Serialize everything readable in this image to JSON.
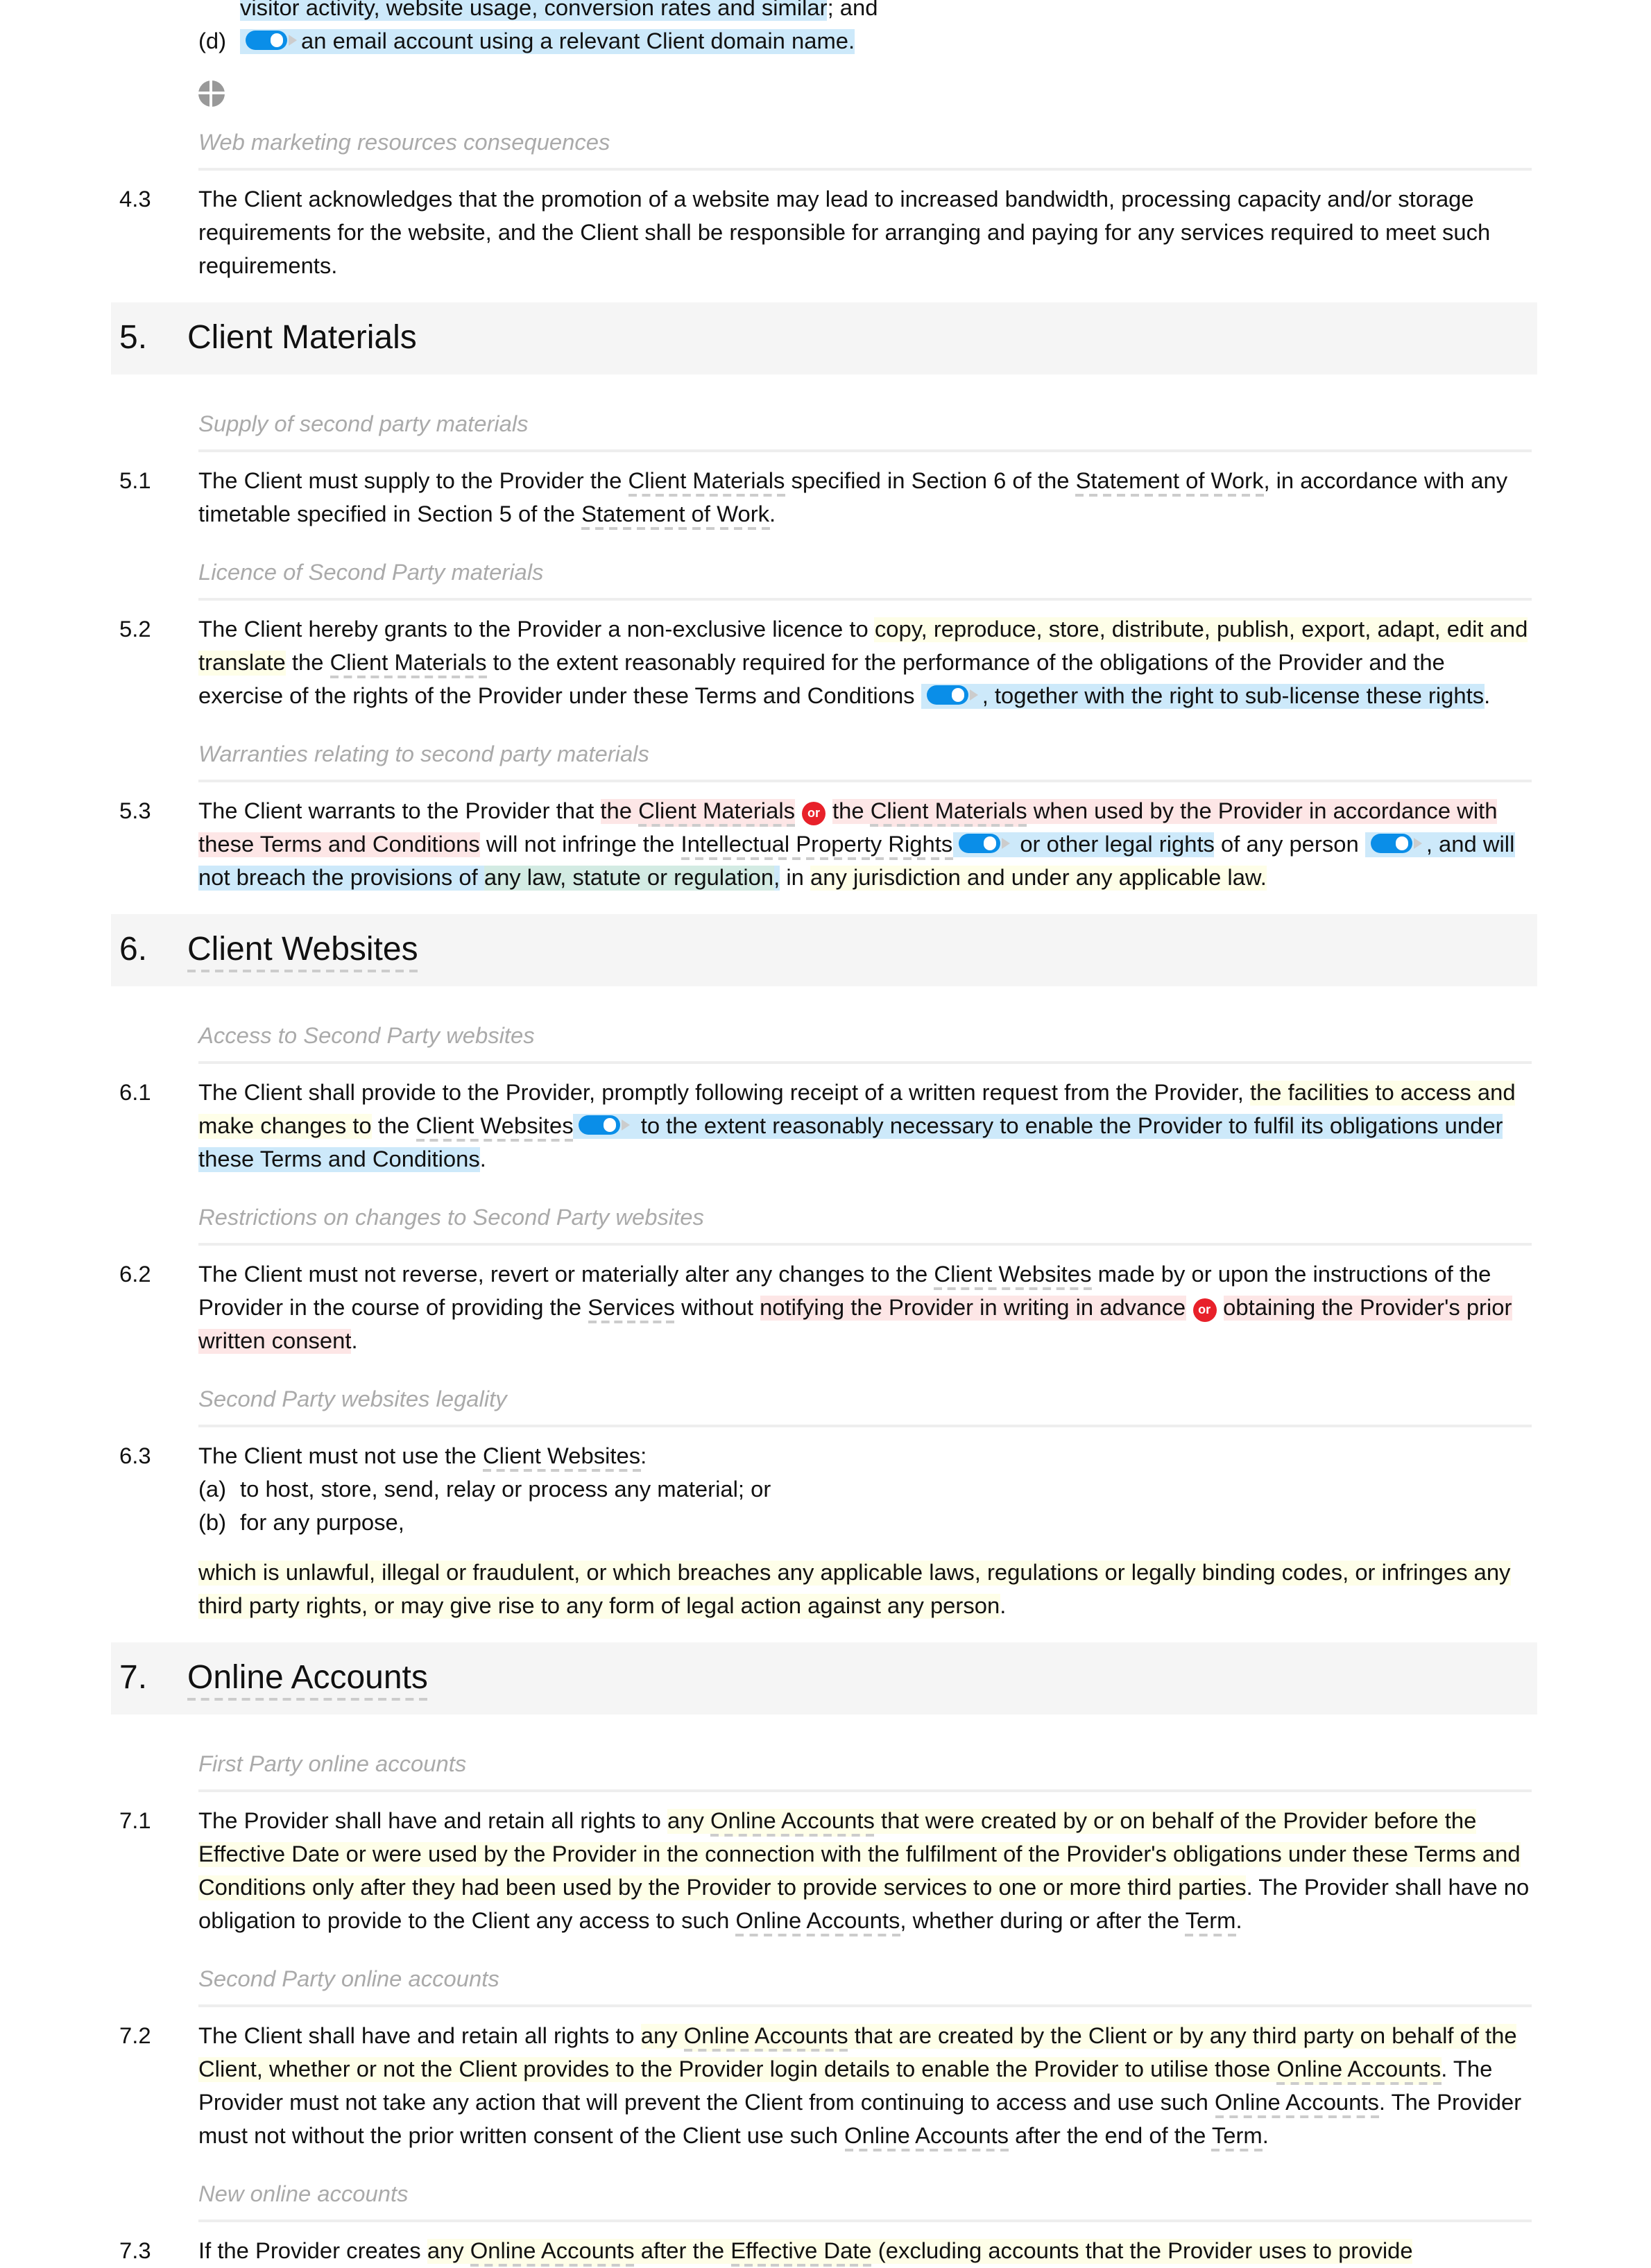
{
  "intro": {
    "c_tail": [
      {
        "t": "visitor activity, website usage, conversion rates and similar",
        "h": "b"
      },
      {
        "t": "; and"
      }
    ],
    "d_label": "(d)",
    "d_segs": [
      {
        "toggle": true,
        "h": "b"
      },
      {
        "t": "an email account using a relevant Client domain name.",
        "h": "b"
      }
    ]
  },
  "blocks": [
    {
      "type": "sub",
      "text": "Web marketing resources consequences"
    },
    {
      "type": "para",
      "num": "4.3",
      "segs": [
        {
          "t": "The Client acknowledges that the promotion of a website may lead to increased bandwidth, processing capacity and/or storage requirements for the website, and the Client shall be responsible for arranging and paying for any services required to meet such requirements."
        }
      ]
    },
    {
      "type": "heading",
      "num": "5.",
      "title": "Client Materials",
      "term": false
    },
    {
      "type": "sub",
      "text": "Supply of second party materials"
    },
    {
      "type": "para",
      "num": "5.1",
      "segs": [
        {
          "t": "The Client must supply to the Provider the "
        },
        {
          "t": "Client Materials",
          "d": 1
        },
        {
          "t": " specified in Section 6 of the "
        },
        {
          "t": "Statement of Work",
          "d": 1
        },
        {
          "t": ", in accordance with any timetable specified in Section 5 of the "
        },
        {
          "t": "Statement of Work",
          "d": 1
        },
        {
          "t": "."
        }
      ]
    },
    {
      "type": "sub",
      "text": "Licence of Second Party materials"
    },
    {
      "type": "para",
      "num": "5.2",
      "segs": [
        {
          "t": "The Client hereby grants to the Provider a non-exclusive licence to "
        },
        {
          "t": "copy, reproduce, store, distribute, publish, export, adapt, edit and translate",
          "h": "y"
        },
        {
          "t": " the "
        },
        {
          "t": "Client Materials",
          "d": 1
        },
        {
          "t": " to the extent reasonably required for the performance of the obligations of the Provider and the exercise of the rights of the Provider under these Terms and Conditions "
        },
        {
          "toggle": true,
          "h": "b"
        },
        {
          "t": ", together with the right to sub-license these rights",
          "h": "b"
        },
        {
          "t": "."
        }
      ]
    },
    {
      "type": "sub",
      "text": "Warranties relating to second party materials"
    },
    {
      "type": "para",
      "num": "5.3",
      "segs": [
        {
          "t": "The Client warrants to the Provider that "
        },
        {
          "t": "the ",
          "h": "p"
        },
        {
          "t": "Client Materials",
          "h": "p",
          "d": 1
        },
        {
          "or": "or"
        },
        {
          "t": "the ",
          "h": "p"
        },
        {
          "t": "Client Materials",
          "h": "p",
          "d": 1
        },
        {
          "t": " when used by the Provider in accordance with these Terms and Conditions",
          "h": "p"
        },
        {
          "t": " will not infringe the "
        },
        {
          "t": "Intellectual Property Rights",
          "d": 1
        },
        {
          "toggle": true,
          "h": "b"
        },
        {
          "t": " or other legal rights",
          "h": "b"
        },
        {
          "t": " of any person "
        },
        {
          "toggle": true,
          "h": "b"
        },
        {
          "t": ", and will not breach the provisions of ",
          "h": "b"
        },
        {
          "t": "any law, statute or regulation",
          "h": "g"
        },
        {
          "t": ",",
          "h": "b"
        },
        {
          "t": " in "
        },
        {
          "t": "any jurisdiction and under any applicable law.",
          "h": "y"
        }
      ]
    },
    {
      "type": "heading",
      "num": "6.",
      "title": "Client Websites",
      "term": true
    },
    {
      "type": "sub",
      "text": "Access to Second Party websites"
    },
    {
      "type": "para",
      "num": "6.1",
      "segs": [
        {
          "t": "The Client shall provide to the Provider, promptly following receipt of a written request from the Provider, "
        },
        {
          "t": "the facilities to access and make changes to",
          "h": "y"
        },
        {
          "t": " the "
        },
        {
          "t": "Client Websites",
          "d": 1
        },
        {
          "toggle": true,
          "h": "b"
        },
        {
          "t": " to the extent reasonably necessary to enable the Provider to fulfil its obligations under these Terms and Conditions",
          "h": "b"
        },
        {
          "t": "."
        }
      ]
    },
    {
      "type": "sub",
      "text": "Restrictions on changes to Second Party websites"
    },
    {
      "type": "para",
      "num": "6.2",
      "segs": [
        {
          "t": "The Client must not reverse, revert or materially alter any changes to the "
        },
        {
          "t": "Client Websites",
          "d": 1
        },
        {
          "t": " made by or upon the instructions of the Provider in the course of providing the "
        },
        {
          "t": "Services",
          "d": 1
        },
        {
          "t": " without "
        },
        {
          "t": "notifying the Provider in writing in advance",
          "h": "p"
        },
        {
          "or": "or"
        },
        {
          "t": "obtaining the Provider's prior written consent",
          "h": "p"
        },
        {
          "t": "."
        }
      ]
    },
    {
      "type": "sub",
      "text": "Second Party websites legality"
    },
    {
      "type": "para",
      "num": "6.3",
      "segs": [
        {
          "t": "The Client must not use the "
        },
        {
          "t": "Client Websites",
          "d": 1
        },
        {
          "t": ":"
        }
      ],
      "items": [
        {
          "label": "(a)",
          "text": "to host, store, send, relay or process any material; or"
        },
        {
          "label": "(b)",
          "text": "for any purpose,"
        }
      ],
      "tail": [
        {
          "t": "which is unlawful, illegal or fraudulent, or which breaches any applicable laws, regulations or legally binding codes, or infringes any third party rights, or may give rise to any form of legal action against any person",
          "h": "y"
        },
        {
          "t": "."
        }
      ]
    },
    {
      "type": "heading",
      "num": "7.",
      "title": "Online Accounts",
      "term": true
    },
    {
      "type": "sub",
      "text": "First Party online accounts"
    },
    {
      "type": "para",
      "num": "7.1",
      "segs": [
        {
          "t": "The Provider shall have and retain all rights to "
        },
        {
          "t": "any ",
          "h": "y"
        },
        {
          "t": "Online Accounts",
          "h": "y",
          "d": 1
        },
        {
          "t": " that were created by or on behalf of the Provider before the Effective Date or were used by the Provider in the connection with the fulfilment of the Provider's obligations under these Terms and Conditions only after they had been used by the Provider to provide services to one or more third parties",
          "h": "y"
        },
        {
          "t": ". The Provider shall have no obligation to provide to the Client any access to such "
        },
        {
          "t": "Online Accounts",
          "d": 1
        },
        {
          "t": ", whether during or after the "
        },
        {
          "t": "Term",
          "d": 1
        },
        {
          "t": "."
        }
      ]
    },
    {
      "type": "sub",
      "text": "Second Party online accounts"
    },
    {
      "type": "para",
      "num": "7.2",
      "segs": [
        {
          "t": "The Client shall have and retain all rights to "
        },
        {
          "t": "any ",
          "h": "y"
        },
        {
          "t": "Online Accounts",
          "h": "y",
          "d": 1
        },
        {
          "t": " that are created by the Client or by any third party on behalf of the Client, whether or not the Client provides to the Provider login details to enable the Provider to utilise those ",
          "h": "y"
        },
        {
          "t": "Online Accounts",
          "h": "y",
          "d": 1
        },
        {
          "t": ". The Provider must not take any action that will prevent the Client from continuing to access and use such "
        },
        {
          "t": "Online Accounts",
          "d": 1
        },
        {
          "t": ". The Provider must not without the prior written consent of the Client use such "
        },
        {
          "t": "Online Accounts",
          "d": 1
        },
        {
          "t": " after the end of the "
        },
        {
          "t": "Term",
          "d": 1
        },
        {
          "t": "."
        }
      ]
    },
    {
      "type": "sub",
      "text": "New online accounts"
    },
    {
      "type": "para",
      "num": "7.3",
      "segs": [
        {
          "t": "If the Provider creates "
        },
        {
          "t": "any ",
          "h": "y"
        },
        {
          "t": "Online Accounts",
          "h": "y",
          "d": 1
        },
        {
          "t": " after the ",
          "h": "y"
        },
        {
          "t": "Effective Date",
          "h": "y",
          "d": 1
        },
        {
          "t": " (excluding accounts that the Provider uses to provide",
          "h": "y"
        }
      ]
    }
  ]
}
